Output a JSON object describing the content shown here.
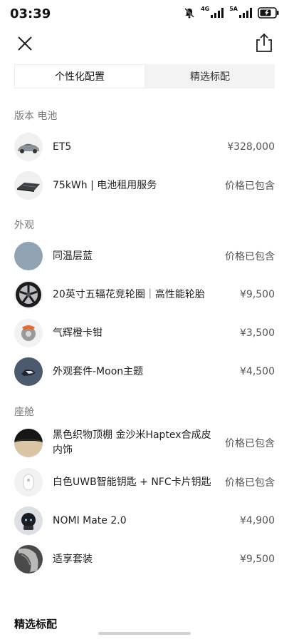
{
  "status_bar": {
    "time": "03:39",
    "network_1": "4G",
    "network_2": "5A"
  },
  "tabs": [
    {
      "label": "个性化配置",
      "active": true
    },
    {
      "label": "精选标配",
      "active": false
    }
  ],
  "sections": {
    "battery": {
      "title": "版本 电池",
      "items": [
        {
          "name": "ET5",
          "price": "¥328,000",
          "thumb": "car-thumbnail"
        },
        {
          "name": "75kWh | 电池租用服务",
          "price": "价格已包含",
          "thumb": "battery-pack-thumbnail"
        }
      ]
    },
    "exterior": {
      "title": "外观",
      "items": [
        {
          "name": "同温层蓝",
          "price": "价格已包含",
          "thumb": "paint-swatch",
          "color": "#8fa3b3"
        },
        {
          "name": "20英寸五辐花竞轮圈｜高性能轮胎",
          "price": "¥9,500",
          "thumb": "wheel-rim-thumbnail"
        },
        {
          "name": "气辉橙卡钳",
          "price": "¥3,500",
          "thumb": "brake-caliper-thumbnail",
          "color": "#e86a2c"
        },
        {
          "name": "外观套件-Moon主题",
          "price": "¥4,500",
          "thumb": "exterior-kit-thumbnail",
          "color": "#4b5a6c"
        }
      ]
    },
    "cabin": {
      "title": "座舱",
      "items": [
        {
          "name": "黑色织物顶棚 金沙米Haptex合成皮内饰",
          "price": "价格已包含",
          "thumb": "interior-trim-thumbnail",
          "color": "#d9c4a4"
        },
        {
          "name": "白色UWB智能钥匙 + NFC卡片钥匙",
          "price": "价格已包含",
          "thumb": "smart-key-thumbnail"
        },
        {
          "name": "NOMI Mate 2.0",
          "price": "¥4,900",
          "thumb": "nomi-thumbnail"
        },
        {
          "name": "适享套装",
          "price": "¥9,500",
          "thumb": "seat-package-thumbnail"
        }
      ]
    }
  },
  "bottom_title": "精选标配"
}
